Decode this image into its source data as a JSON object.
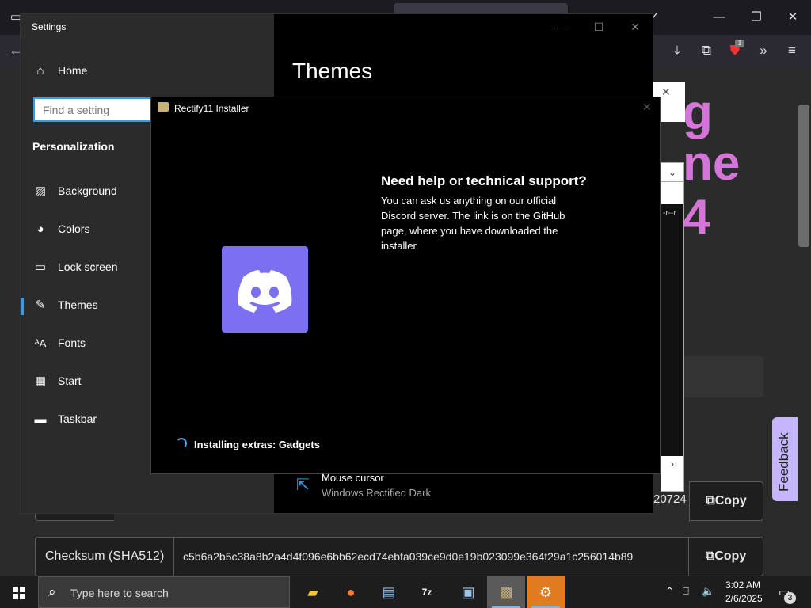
{
  "browser": {
    "heading_lines": [
      "g",
      "ne",
      "4"
    ],
    "extension_badge": "1",
    "feedback_label": "Feedback",
    "hash_link_fragment": "20724",
    "copy_label": "Copy",
    "checksum_label": "Checksum (SHA512)",
    "checksum_value": "c5b6a2b5c38a8b2a4d4f096e6bb62ecd74ebfa039ce9d0e19b023099e364f29a1c256014b89"
  },
  "settings": {
    "title": "Settings",
    "home_label": "Home",
    "search_placeholder": "Find a setting",
    "section": "Personalization",
    "nav": [
      {
        "label": "Background",
        "icon": "image-icon"
      },
      {
        "label": "Colors",
        "icon": "palette-icon"
      },
      {
        "label": "Lock screen",
        "icon": "lock-screen-icon"
      },
      {
        "label": "Themes",
        "icon": "brush-icon"
      },
      {
        "label": "Fonts",
        "icon": "font-icon"
      },
      {
        "label": "Start",
        "icon": "start-icon"
      },
      {
        "label": "Taskbar",
        "icon": "taskbar-icon"
      }
    ],
    "active_nav": "Themes",
    "page_title": "Themes",
    "mouse_cursor_label": "Mouse cursor",
    "mouse_cursor_value": "Windows Rectified Dark",
    "accent_color": "#3b9ae1"
  },
  "installer": {
    "title": "Rectify11 Installer",
    "help_title": "Need help or technical support?",
    "help_body": "You can ask us anything on our official Discord server. The link is on the GitHub page, where you have downloaded the installer.",
    "status": "Installing extras: Gadgets",
    "discord_color": "#7c6ff0"
  },
  "taskbar": {
    "search_placeholder": "Type here to search",
    "time": "3:02 AM",
    "date": "2/6/2025",
    "notifications": "3",
    "apps": [
      "file-explorer",
      "firefox",
      "network-app",
      "7-zip",
      "control-panel",
      "installer",
      "settings"
    ]
  }
}
